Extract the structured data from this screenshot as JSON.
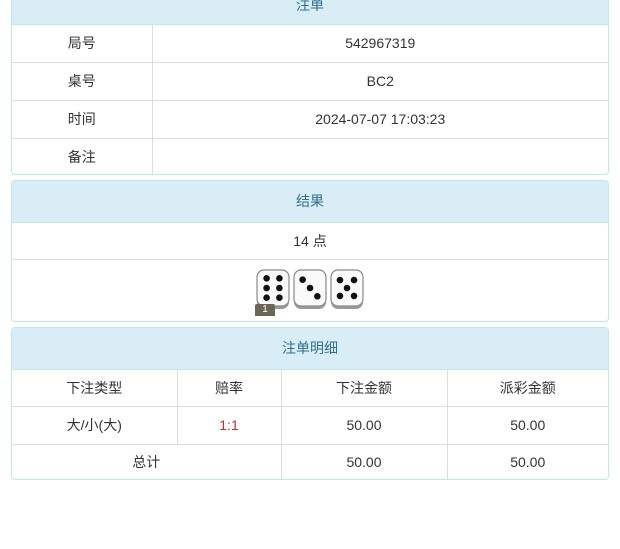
{
  "order": {
    "title": "注单",
    "rows": [
      {
        "label": "局号",
        "value": "542967319"
      },
      {
        "label": "桌号",
        "value": "BC2"
      },
      {
        "label": "时间",
        "value": "2024-07-07 17:03:23"
      },
      {
        "label": "备注",
        "value": ""
      }
    ]
  },
  "result": {
    "title": "结果",
    "points": "14 点",
    "dice": [
      6,
      3,
      5
    ],
    "badge": "1"
  },
  "detail": {
    "title": "注单明细",
    "headers": [
      "下注类型",
      "赔率",
      "下注金额",
      "派彩金额"
    ],
    "row": {
      "type": "大/小(大)",
      "odds": "1:1",
      "bet": "50.00",
      "payout": "50.00"
    },
    "total": {
      "label": "总计",
      "bet": "50.00",
      "payout": "50.00"
    }
  },
  "colors": {
    "panel_header_bg": "#d9edf7",
    "panel_border": "#bce8f1",
    "odds_red": "#c9302c"
  }
}
